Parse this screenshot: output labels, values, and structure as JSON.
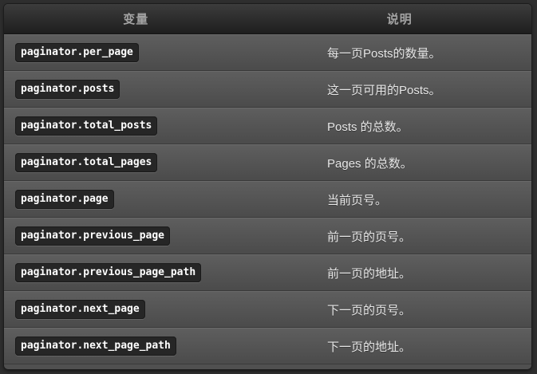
{
  "table": {
    "headers": {
      "variable": "变量",
      "description": "说明"
    },
    "rows": [
      {
        "variable": "paginator.per_page",
        "description": "每一页Posts的数量。"
      },
      {
        "variable": "paginator.posts",
        "description": "这一页可用的Posts。"
      },
      {
        "variable": "paginator.total_posts",
        "description": "Posts 的总数。"
      },
      {
        "variable": "paginator.total_pages",
        "description": "Pages 的总数。"
      },
      {
        "variable": "paginator.page",
        "description": "当前页号。"
      },
      {
        "variable": "paginator.previous_page",
        "description": "前一页的页号。"
      },
      {
        "variable": "paginator.previous_page_path",
        "description": "前一页的地址。"
      },
      {
        "variable": "paginator.next_page",
        "description": "下一页的页号。"
      },
      {
        "variable": "paginator.next_page_path",
        "description": "下一页的地址。"
      }
    ]
  }
}
